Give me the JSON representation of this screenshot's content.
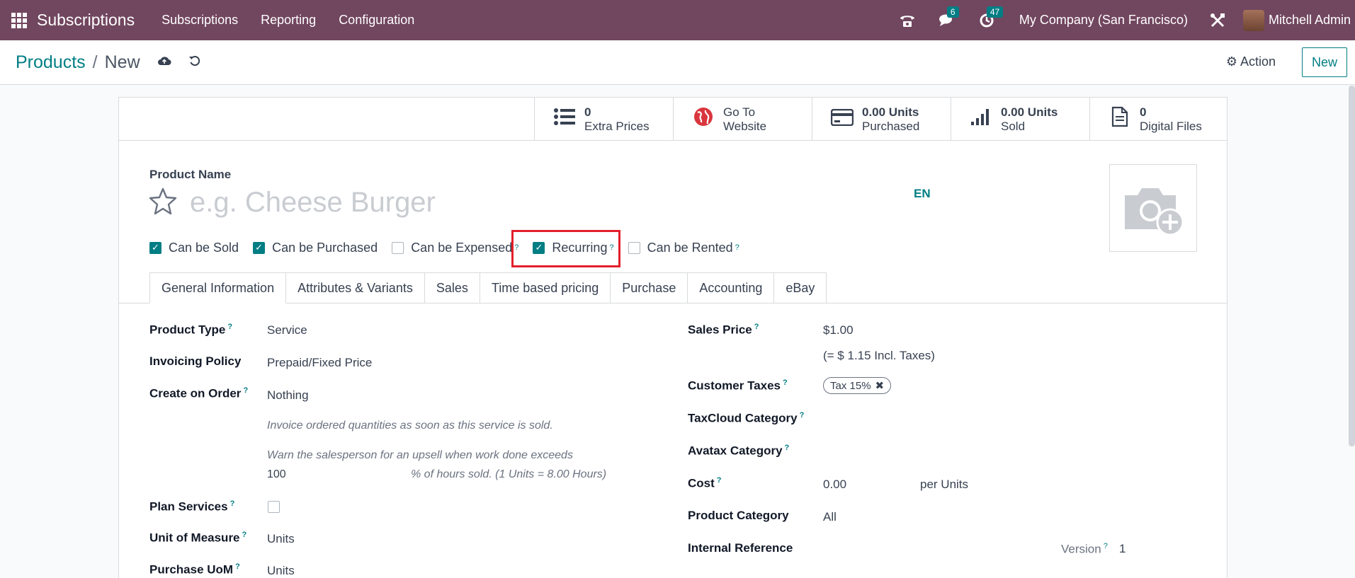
{
  "navbar": {
    "brand": "Subscriptions",
    "menu": [
      "Subscriptions",
      "Reporting",
      "Configuration"
    ],
    "messages_count": "6",
    "activities_count": "47",
    "company": "My Company (San Francisco)",
    "user": "Mitchell Admin"
  },
  "control": {
    "breadcrumb_parent": "Products",
    "breadcrumb_sep": "/",
    "breadcrumb_current": "New",
    "action_label": "Action",
    "new_label": "New"
  },
  "smart_buttons": [
    {
      "icon": "list-icon",
      "value": "0",
      "label": "Extra Prices"
    },
    {
      "icon": "globe-icon",
      "value": "Go To",
      "label": "Website"
    },
    {
      "icon": "credit-card-icon",
      "value": "0.00 Units",
      "label": "Purchased"
    },
    {
      "icon": "signal-icon",
      "value": "0.00 Units",
      "label": "Sold"
    },
    {
      "icon": "file-icon",
      "value": "0",
      "label": "Digital Files"
    }
  ],
  "form": {
    "product_name_label": "Product Name",
    "product_name_placeholder": "e.g. Cheese Burger",
    "lang": "EN",
    "checkboxes": [
      {
        "label": "Can be Sold",
        "checked": true,
        "help": false
      },
      {
        "label": "Can be Purchased",
        "checked": true,
        "help": false
      },
      {
        "label": "Can be Expensed",
        "checked": false,
        "help": true
      },
      {
        "label": "Recurring",
        "checked": true,
        "help": true
      },
      {
        "label": "Can be Rented",
        "checked": false,
        "help": true
      }
    ],
    "tabs": [
      "General Information",
      "Attributes & Variants",
      "Sales",
      "Time based pricing",
      "Purchase",
      "Accounting",
      "eBay"
    ],
    "help_mark": "?",
    "left": {
      "product_type_label": "Product Type",
      "product_type_value": "Service",
      "invoicing_policy_label": "Invoicing Policy",
      "invoicing_policy_value": "Prepaid/Fixed Price",
      "create_on_order_label": "Create on Order",
      "create_on_order_value": "Nothing",
      "invoice_note": "Invoice ordered quantities as soon as this service is sold.",
      "upsell_note": "Warn the salesperson for an upsell when work done exceeds",
      "upsell_value": "100",
      "upsell_suffix": "% of hours sold. (1 Units = 8.00 Hours)",
      "plan_services_label": "Plan Services",
      "uom_label": "Unit of Measure",
      "uom_value": "Units",
      "purchase_uom_label": "Purchase UoM",
      "purchase_uom_value": "Units"
    },
    "right": {
      "sales_price_label": "Sales Price",
      "sales_price_value": "$1.00",
      "sales_price_incl": "(= $ 1.15 Incl. Taxes)",
      "customer_taxes_label": "Customer Taxes",
      "customer_tax_tag": "Tax 15%",
      "taxcloud_label": "TaxCloud Category",
      "avatax_label": "Avatax Category",
      "cost_label": "Cost",
      "cost_value": "0.00",
      "cost_unit": "per Units",
      "product_category_label": "Product Category",
      "product_category_value": "All",
      "internal_ref_label": "Internal Reference",
      "version_label": "Version",
      "version_value": "1"
    }
  }
}
